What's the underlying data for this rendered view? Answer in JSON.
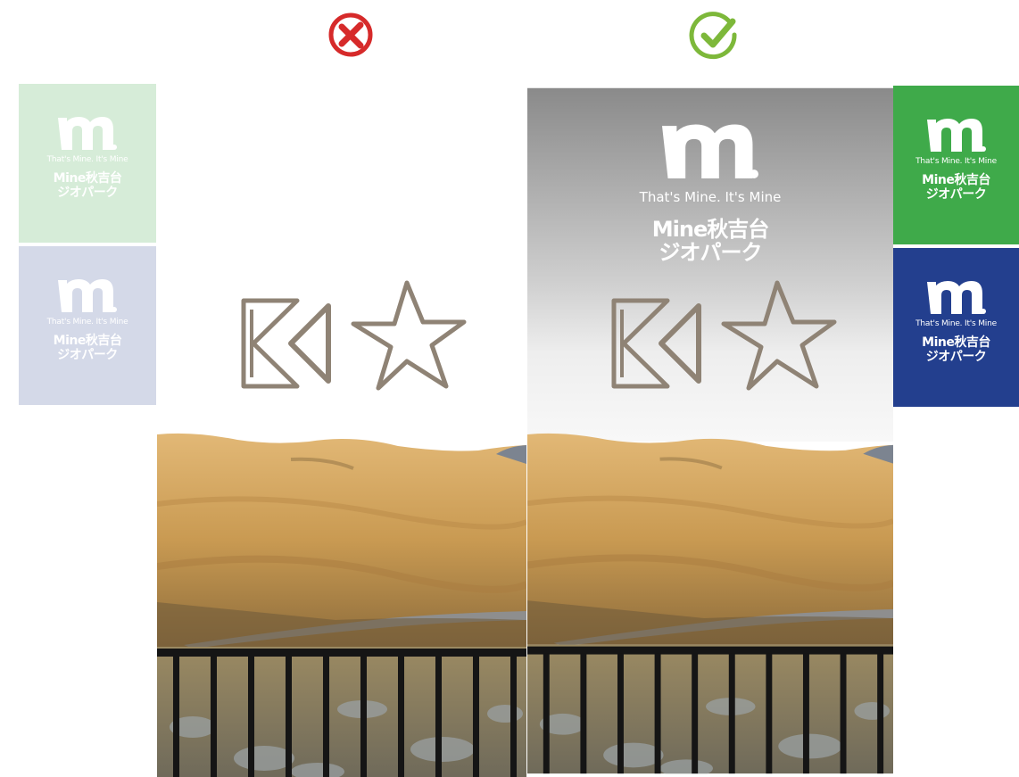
{
  "colors": {
    "wrong": "#d62a2a",
    "correct": "#7db83a",
    "tile_green_faded": "#d6ecd8",
    "tile_blue_faded": "#d4d9e8",
    "tile_green": "#3faa4a",
    "tile_blue": "#233f8e",
    "overlay_gray": "#8a8a8a"
  },
  "icons": {
    "wrong": "x-circle-icon",
    "correct": "check-circle-icon"
  },
  "brand": {
    "tagline": "That's Mine. It's Mine",
    "name_line1": "Mine秋吉台",
    "name_line2": "ジオパーク"
  }
}
